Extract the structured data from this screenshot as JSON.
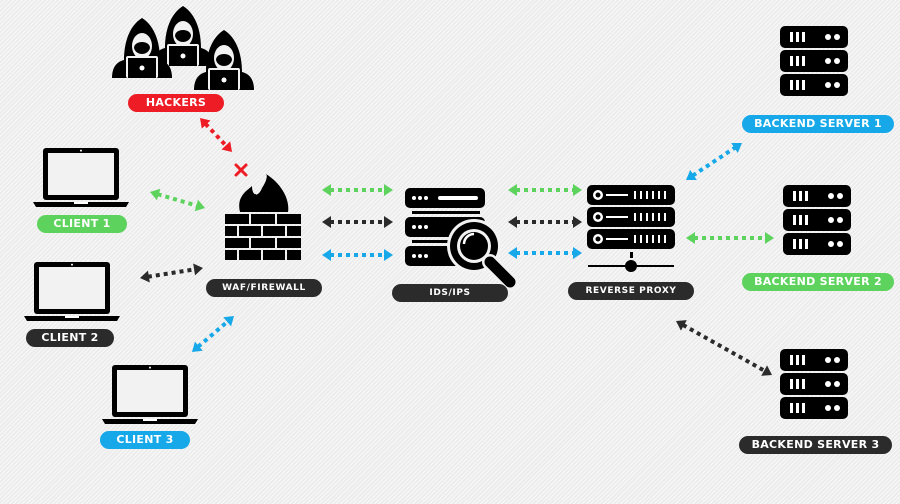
{
  "colors": {
    "red": "#ee1c24",
    "green": "#5dd35d",
    "dark": "#2b2b2b",
    "blue": "#16a8e8",
    "icon": "#000000"
  },
  "nodes": {
    "hackers": {
      "label": "HACKERS",
      "color": "red",
      "icon": "hooded-hackers-icon"
    },
    "client1": {
      "label": "CLIENT 1",
      "color": "green",
      "icon": "laptop-icon"
    },
    "client2": {
      "label": "CLIENT 2",
      "color": "dark",
      "icon": "laptop-icon"
    },
    "client3": {
      "label": "CLIENT 3",
      "color": "blue",
      "icon": "laptop-icon"
    },
    "waf": {
      "label": "WAF/FIREWALL",
      "color": "dark",
      "icon": "firewall-icon"
    },
    "ids": {
      "label": "IDS/IPS",
      "color": "dark",
      "icon": "server-magnifier-icon"
    },
    "proxy": {
      "label": "REVERSE PROXY",
      "color": "dark",
      "icon": "network-server-icon"
    },
    "backend1": {
      "label": "BACKEND SERVER 1",
      "color": "blue",
      "icon": "server-rack-icon"
    },
    "backend2": {
      "label": "BACKEND SERVER 2",
      "color": "green",
      "icon": "server-rack-icon"
    },
    "backend3": {
      "label": "BACKEND SERVER 3",
      "color": "dark",
      "icon": "server-rack-icon"
    }
  },
  "edges": [
    {
      "from": "hackers",
      "to": "waf",
      "color": "red",
      "blocked": true
    },
    {
      "from": "client1",
      "to": "waf",
      "color": "green"
    },
    {
      "from": "client2",
      "to": "waf",
      "color": "dark"
    },
    {
      "from": "client3",
      "to": "waf",
      "color": "blue"
    },
    {
      "from": "waf",
      "to": "ids",
      "color": "green"
    },
    {
      "from": "waf",
      "to": "ids",
      "color": "dark"
    },
    {
      "from": "waf",
      "to": "ids",
      "color": "blue"
    },
    {
      "from": "ids",
      "to": "proxy",
      "color": "green"
    },
    {
      "from": "ids",
      "to": "proxy",
      "color": "dark"
    },
    {
      "from": "ids",
      "to": "proxy",
      "color": "blue"
    },
    {
      "from": "proxy",
      "to": "backend1",
      "color": "blue"
    },
    {
      "from": "proxy",
      "to": "backend2",
      "color": "green"
    },
    {
      "from": "proxy",
      "to": "backend3",
      "color": "dark"
    }
  ]
}
